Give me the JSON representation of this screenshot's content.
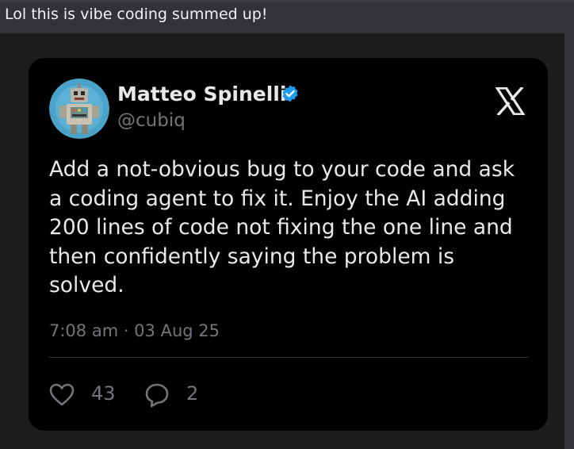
{
  "message": {
    "text": "Lol this is vibe coding summed up!"
  },
  "tweet": {
    "author_name": "Matteo Spinelli",
    "handle": "@cubiq",
    "avatar_icon": "robot-avatar-icon",
    "verified_icon": "verified-badge-icon",
    "platform_icon": "x-logo-icon",
    "body_lines": [
      "Add a not-obvious bug to your code and ask",
      "a coding agent to fix it. Enjoy the AI adding",
      "200 lines of code not fixing the one line and",
      "then confidently saying the problem is",
      "solved."
    ],
    "timestamp": "7:08 am · 03 Aug 25",
    "likes": "43",
    "replies": "2"
  },
  "colors": {
    "page_background": "#313338",
    "card_background": "#000000",
    "verified_blue": "#1d9bf0",
    "muted_text": "#71767b"
  }
}
